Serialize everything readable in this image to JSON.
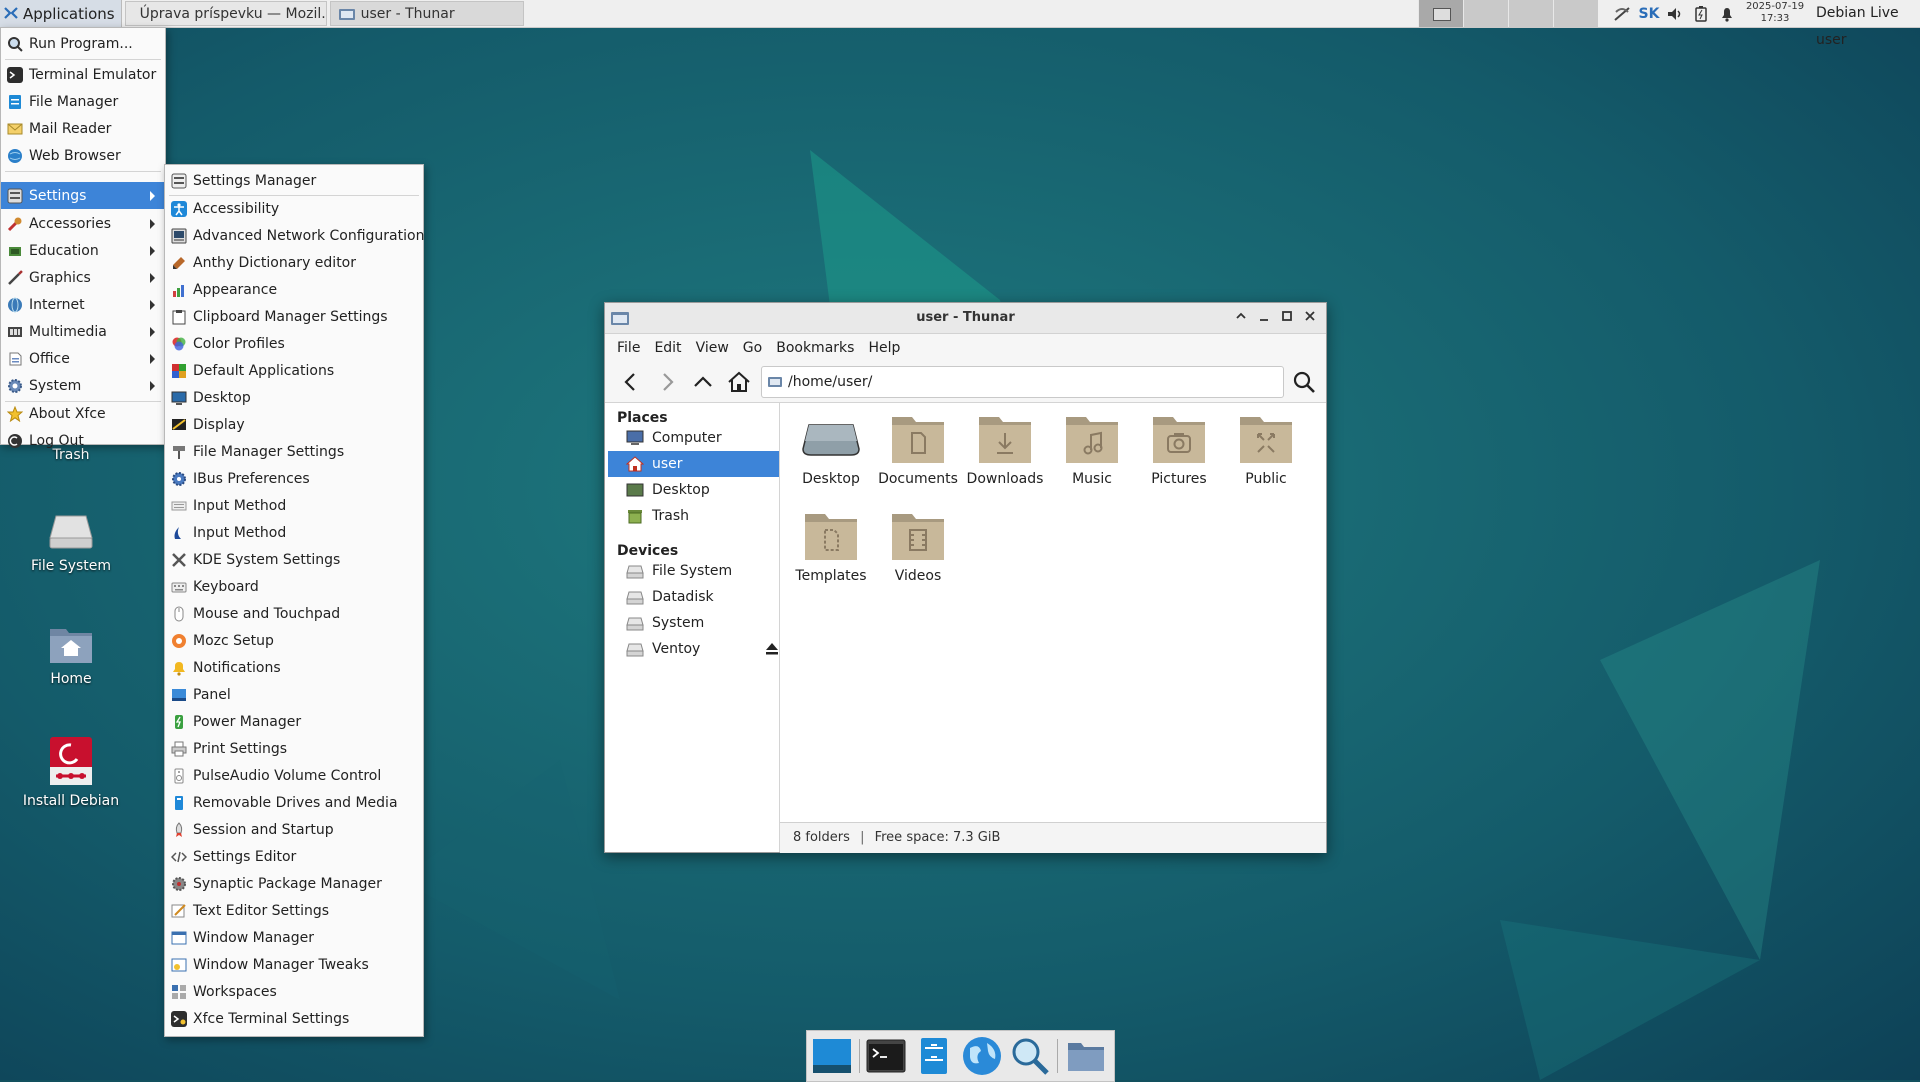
{
  "top_panel": {
    "applications_label": "Applications",
    "tasks": [
      {
        "label": "Úprava príspevku — Mozil...",
        "icon": "firefox-icon"
      },
      {
        "label": "user - Thunar",
        "icon": "folder-icon"
      }
    ],
    "keyboard_layout": "SK",
    "date": "2025-07-19",
    "time": "17:33",
    "user": "Debian Live user"
  },
  "app_menu": {
    "items": [
      {
        "label": "Run Program...",
        "icon": "run-program-icon"
      },
      {
        "label": "Terminal Emulator",
        "icon": "terminal-icon"
      },
      {
        "label": "File Manager",
        "icon": "file-manager-icon"
      },
      {
        "label": "Mail Reader",
        "icon": "mail-icon"
      },
      {
        "label": "Web Browser",
        "icon": "web-browser-icon"
      },
      {
        "label": "Settings",
        "icon": "settings-icon",
        "submenu": true,
        "selected": true
      },
      {
        "label": "Accessories",
        "icon": "accessories-icon",
        "submenu": true
      },
      {
        "label": "Education",
        "icon": "education-icon",
        "submenu": true
      },
      {
        "label": "Graphics",
        "icon": "graphics-icon",
        "submenu": true
      },
      {
        "label": "Internet",
        "icon": "internet-icon",
        "submenu": true
      },
      {
        "label": "Multimedia",
        "icon": "multimedia-icon",
        "submenu": true
      },
      {
        "label": "Office",
        "icon": "office-icon",
        "submenu": true
      },
      {
        "label": "System",
        "icon": "system-icon",
        "submenu": true
      },
      {
        "label": "About Xfce",
        "icon": "star-icon"
      },
      {
        "label": "Log Out",
        "icon": "logout-icon"
      }
    ]
  },
  "settings_menu": {
    "items": [
      {
        "label": "Settings Manager",
        "icon": "settings-manager-icon"
      },
      {
        "label": "Accessibility",
        "icon": "accessibility-icon"
      },
      {
        "label": "Advanced Network Configuration",
        "icon": "network-icon"
      },
      {
        "label": "Anthy Dictionary editor",
        "icon": "dictionary-icon"
      },
      {
        "label": "Appearance",
        "icon": "appearance-icon"
      },
      {
        "label": "Clipboard Manager Settings",
        "icon": "clipboard-icon"
      },
      {
        "label": "Color Profiles",
        "icon": "color-profiles-icon"
      },
      {
        "label": "Default Applications",
        "icon": "default-apps-icon"
      },
      {
        "label": "Desktop",
        "icon": "desktop-icon"
      },
      {
        "label": "Display",
        "icon": "display-icon"
      },
      {
        "label": "File Manager Settings",
        "icon": "file-manager-settings-icon"
      },
      {
        "label": "IBus Preferences",
        "icon": "ibus-icon"
      },
      {
        "label": "Input Method",
        "icon": "input-method-icon"
      },
      {
        "label": "Input Method",
        "icon": "input-method-2-icon"
      },
      {
        "label": "KDE System Settings",
        "icon": "kde-settings-icon"
      },
      {
        "label": "Keyboard",
        "icon": "keyboard-icon"
      },
      {
        "label": "Mouse and Touchpad",
        "icon": "mouse-icon"
      },
      {
        "label": "Mozc Setup",
        "icon": "mozc-icon"
      },
      {
        "label": "Notifications",
        "icon": "bell-icon"
      },
      {
        "label": "Panel",
        "icon": "panel-icon"
      },
      {
        "label": "Power Manager",
        "icon": "power-icon"
      },
      {
        "label": "Print Settings",
        "icon": "printer-icon"
      },
      {
        "label": "PulseAudio Volume Control",
        "icon": "volume-icon"
      },
      {
        "label": "Removable Drives and Media",
        "icon": "removable-drive-icon"
      },
      {
        "label": "Session and Startup",
        "icon": "rocket-icon"
      },
      {
        "label": "Settings Editor",
        "icon": "settings-editor-icon"
      },
      {
        "label": "Synaptic Package Manager",
        "icon": "synaptic-icon"
      },
      {
        "label": "Text Editor Settings",
        "icon": "text-editor-icon"
      },
      {
        "label": "Window Manager",
        "icon": "window-manager-icon"
      },
      {
        "label": "Window Manager Tweaks",
        "icon": "wm-tweaks-icon"
      },
      {
        "label": "Workspaces",
        "icon": "workspaces-icon"
      },
      {
        "label": "Xfce Terminal Settings",
        "icon": "terminal-settings-icon"
      }
    ]
  },
  "desktop_icons": [
    {
      "label": "Trash",
      "icon": "trash-icon"
    },
    {
      "label": "File System",
      "icon": "drive-icon"
    },
    {
      "label": "Home",
      "icon": "home-folder-icon"
    },
    {
      "label": "Install Debian",
      "icon": "debian-installer-icon"
    }
  ],
  "thunar": {
    "title": "user - Thunar",
    "menubar": [
      "File",
      "Edit",
      "View",
      "Go",
      "Bookmarks",
      "Help"
    ],
    "path": "/home/user/",
    "places_heading": "Places",
    "places": [
      {
        "label": "Computer",
        "icon": "computer-icon"
      },
      {
        "label": "user",
        "icon": "home-icon",
        "selected": true
      },
      {
        "label": "Desktop",
        "icon": "desktop-place-icon"
      },
      {
        "label": "Trash",
        "icon": "trash-icon"
      }
    ],
    "devices_heading": "Devices",
    "devices": [
      {
        "label": "File System",
        "icon": "drive-icon"
      },
      {
        "label": "Datadisk",
        "icon": "drive-icon"
      },
      {
        "label": "System",
        "icon": "drive-icon"
      },
      {
        "label": "Ventoy",
        "icon": "drive-icon",
        "eject": true
      }
    ],
    "folders": [
      {
        "label": "Desktop",
        "icon": "desktop-folder-icon"
      },
      {
        "label": "Documents",
        "icon": "documents-folder-icon"
      },
      {
        "label": "Downloads",
        "icon": "downloads-folder-icon"
      },
      {
        "label": "Music",
        "icon": "music-folder-icon"
      },
      {
        "label": "Pictures",
        "icon": "pictures-folder-icon"
      },
      {
        "label": "Public",
        "icon": "public-folder-icon"
      },
      {
        "label": "Templates",
        "icon": "templates-folder-icon"
      },
      {
        "label": "Videos",
        "icon": "videos-folder-icon"
      }
    ],
    "status_count": "8 folders",
    "status_free": "Free space: 7.3 GiB"
  },
  "dock": [
    {
      "name": "show-desktop",
      "icon": "show-desktop-icon"
    },
    {
      "name": "terminal",
      "icon": "terminal-icon"
    },
    {
      "name": "file-manager",
      "icon": "file-manager-icon"
    },
    {
      "name": "web-browser",
      "icon": "web-browser-icon"
    },
    {
      "name": "app-finder",
      "icon": "magnifier-icon"
    },
    {
      "name": "home-folder",
      "icon": "folder-icon"
    }
  ],
  "colors": {
    "accent": "#3d84d8",
    "wallpaper": "#12505e",
    "folder": "#c8b89a"
  }
}
